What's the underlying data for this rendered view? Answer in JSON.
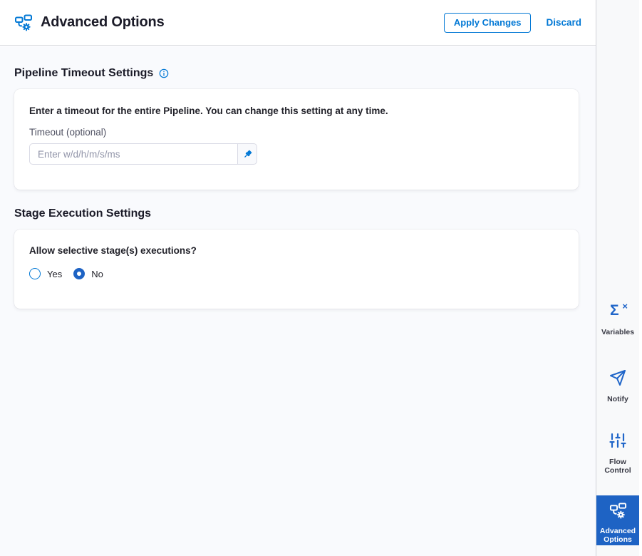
{
  "colors": {
    "accent": "#0278d5",
    "tile": "#1e63c4",
    "icon_blue": "#2066c9"
  },
  "header": {
    "title": "Advanced Options",
    "apply_button": "Apply Changes",
    "discard_button": "Discard"
  },
  "pipeline_timeout": {
    "heading": "Pipeline Timeout Settings",
    "info_icon": "info-icon",
    "description": "Enter a timeout for the entire Pipeline. You can change this setting at any time.",
    "label": "Timeout (optional)",
    "placeholder": "Enter w/d/h/m/s/ms",
    "value": "",
    "pin_icon": "pushpin-icon"
  },
  "stage_execution": {
    "heading": "Stage Execution Settings",
    "question": "Allow selective stage(s) executions?",
    "options": [
      {
        "label": "Yes",
        "selected": false
      },
      {
        "label": "No",
        "selected": true
      }
    ]
  },
  "sidebar": {
    "items": [
      {
        "label": "Variables",
        "icon": "sigma-x-icon",
        "selected": false
      },
      {
        "label": "Notify",
        "icon": "paper-plane-icon",
        "selected": false
      },
      {
        "label": "Flow Control",
        "icon": "sliders-icon",
        "selected": false
      },
      {
        "label": "Advanced Options",
        "icon": "pipeline-gear-icon",
        "selected": true
      }
    ]
  }
}
